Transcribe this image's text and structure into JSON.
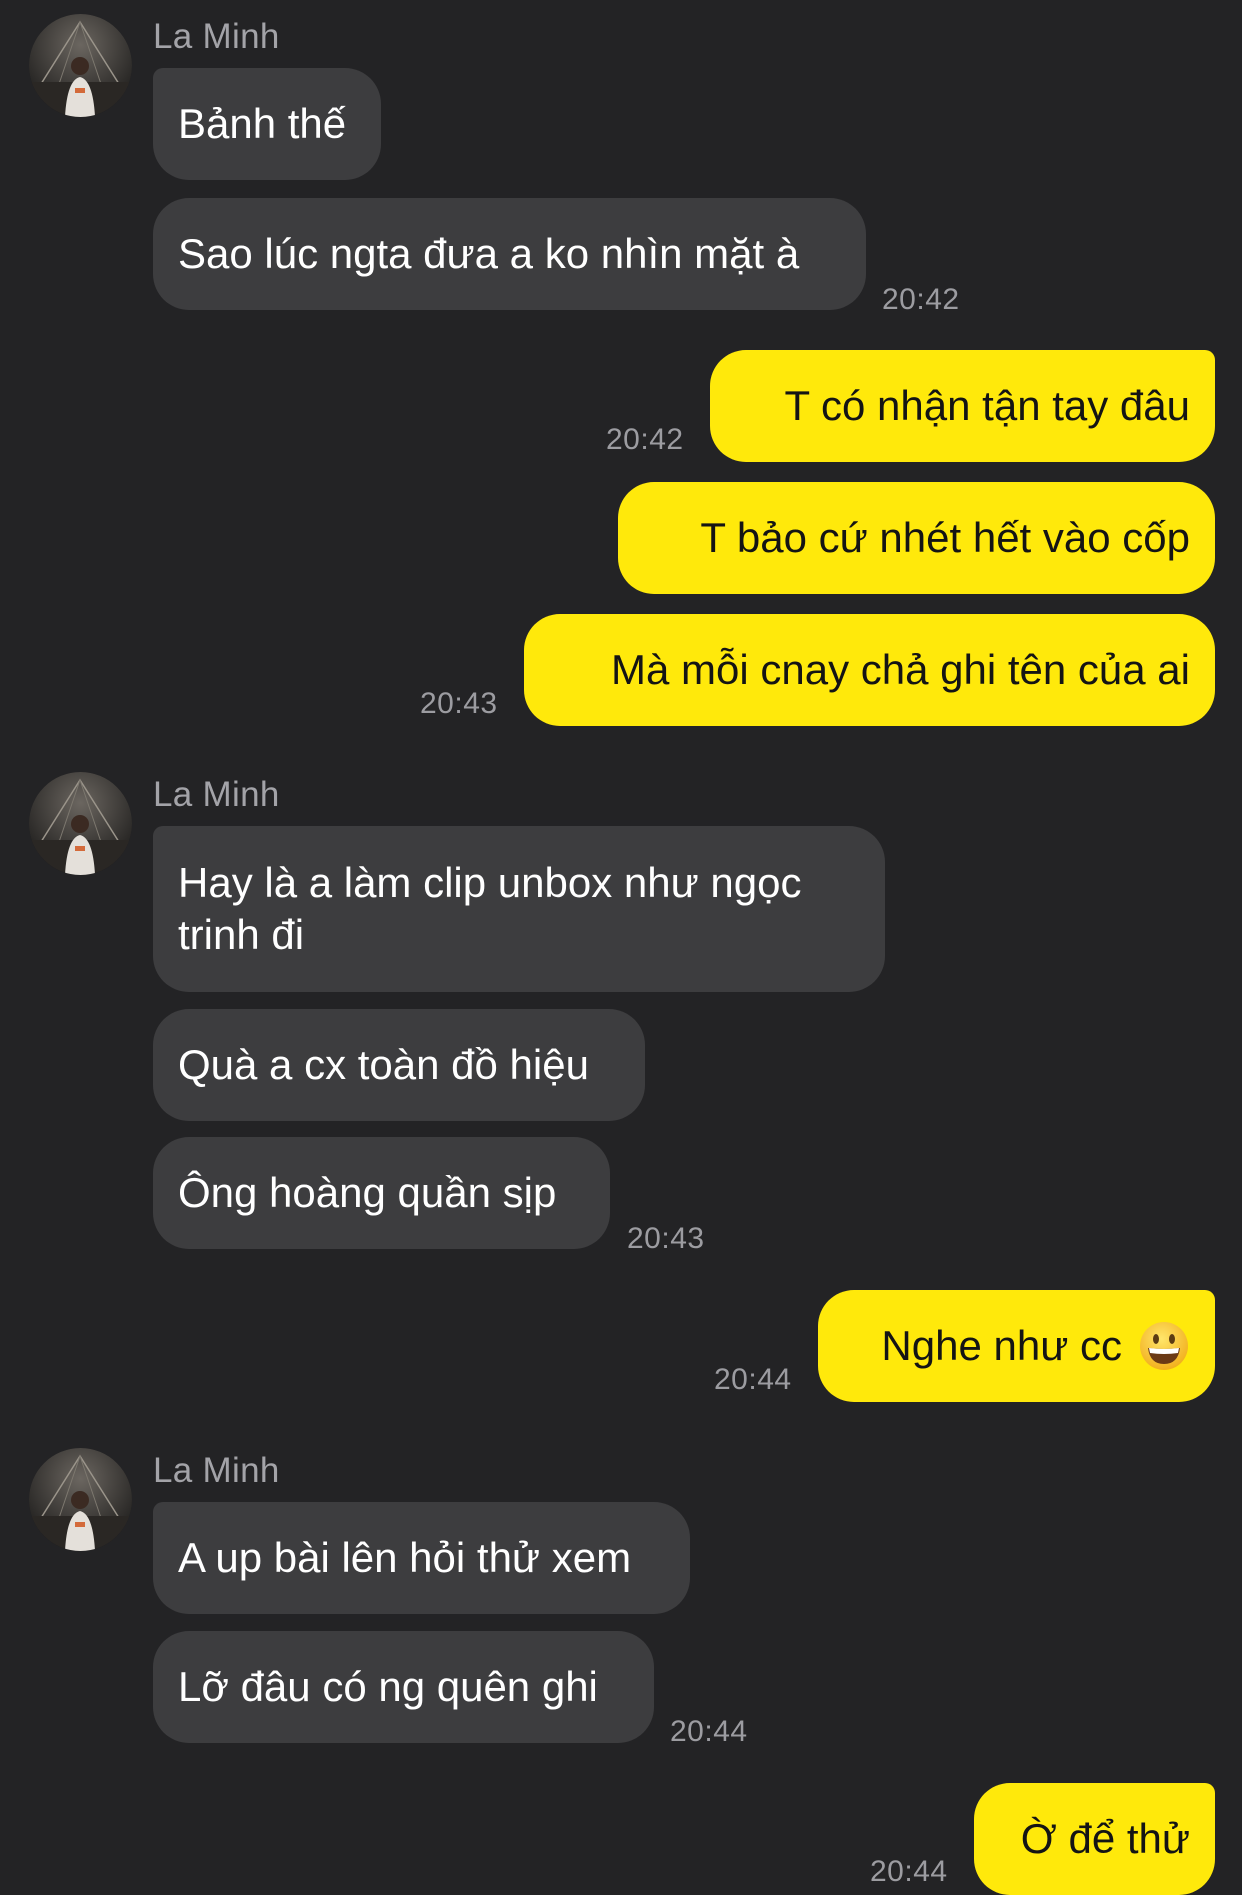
{
  "conversation": {
    "contact_name": "La Minh",
    "groups": [
      {
        "sender": "La Minh",
        "messages": [
          "Bảnh thế",
          "Sao lúc ngta đưa a ko nhìn mặt à"
        ],
        "time": "20:42"
      },
      {
        "sender": "me",
        "messages": [
          "T có nhận tận tay đâu",
          "T bảo cứ nhét hết vào cốp",
          "Mà mỗi cnay chả ghi tên của ai"
        ],
        "times": [
          "20:42",
          "20:43"
        ]
      },
      {
        "sender": "La Minh",
        "messages": [
          "Hay là a làm clip unbox như ngọc trinh đi",
          "Quà a cx toàn đồ hiệu",
          "Ông hoàng quần sịp"
        ],
        "time": "20:43"
      },
      {
        "sender": "me",
        "messages": [
          "Nghe như cc"
        ],
        "emoji": "grinning-face-emoji",
        "time": "20:44"
      },
      {
        "sender": "La Minh",
        "messages": [
          "A up bài lên hỏi thử xem",
          "Lỡ đâu có ng quên ghi"
        ],
        "time": "20:44"
      },
      {
        "sender": "me",
        "messages": [
          "Ờ để thử"
        ],
        "time": "20:44"
      }
    ]
  },
  "colors": {
    "background": "#232325",
    "incoming_bubble": "#3d3d3f",
    "outgoing_bubble": "#ffe90b",
    "timestamp": "#9c9ca1"
  }
}
